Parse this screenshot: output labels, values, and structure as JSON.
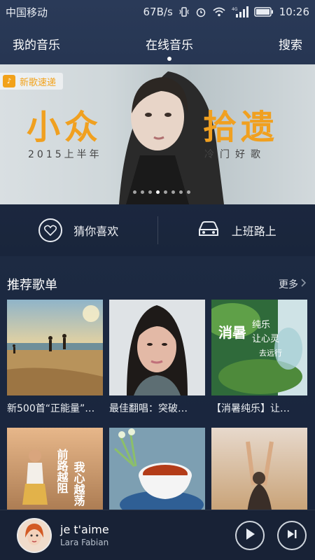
{
  "status_bar": {
    "carrier": "中国移动",
    "speed": "67B/s",
    "signal_label": "4G",
    "time": "10:26"
  },
  "tabs": [
    {
      "label": "我的音乐"
    },
    {
      "label": "在线音乐"
    },
    {
      "label": "搜索"
    }
  ],
  "banner": {
    "badge": "新歌速递",
    "title_left": "小众",
    "title_right": "拾遗",
    "subtitle_left": "2015上半年",
    "subtitle_right": "冷门好歌",
    "dots_total": 8,
    "dots_active_index": 3
  },
  "quick_actions": [
    {
      "label": "猜你喜欢",
      "icon": "heart-icon"
    },
    {
      "label": "上班路上",
      "icon": "car-icon"
    }
  ],
  "section": {
    "title": "推荐歌单",
    "more": "更多"
  },
  "playlists": [
    {
      "title": "新500首“正能量”…",
      "cover": "beach-sunset"
    },
    {
      "title": "最佳翻唱：突破…",
      "cover": "woman-portrait"
    },
    {
      "title": "【消暑纯乐】让…",
      "cover": "waterfall-moss",
      "cover_text": {
        "line1": "消暑",
        "line2": "纯乐",
        "line3": "让心灵",
        "line4": "去远行"
      }
    },
    {
      "title": "",
      "cover": "girl-field",
      "cover_text": {
        "line1": "前路越阻",
        "line2": "我心越荡"
      }
    },
    {
      "title": "",
      "cover": "teacup-flowers"
    },
    {
      "title": "",
      "cover": "woman-arms-up"
    }
  ],
  "player": {
    "song": "je t'aime",
    "artist": "Lara Fabian"
  },
  "colors": {
    "accent": "#f0a020",
    "background": "#1d2a42"
  }
}
